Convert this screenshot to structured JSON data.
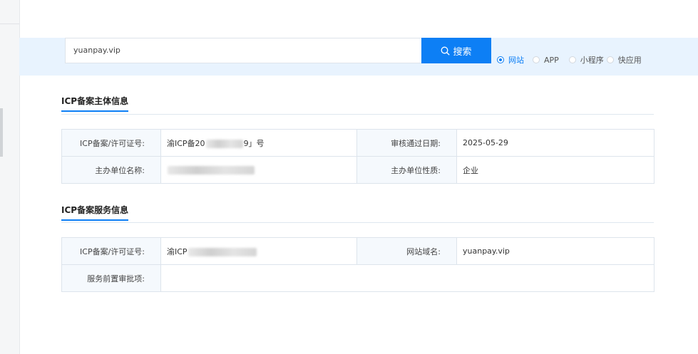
{
  "search": {
    "value": "yuanpay.vip",
    "button_label": "搜索",
    "options": [
      {
        "label": "网站",
        "checked": true
      },
      {
        "label": "APP",
        "checked": false
      },
      {
        "label": "小程序",
        "checked": false
      },
      {
        "label": "快应用",
        "checked": false
      }
    ]
  },
  "subject_section": {
    "title": "ICP备案主体信息",
    "rows": [
      {
        "k1": "ICP备案/许可证号:",
        "v1_prefix": "渝ICP备20",
        "v1_suffix": "9」号",
        "k2": "审核通过日期:",
        "v2": "2025-05-29"
      },
      {
        "k1": "主办单位名称:",
        "v1_prefix": "",
        "v1_suffix": "",
        "k2": "主办单位性质:",
        "v2": "企业"
      }
    ]
  },
  "service_section": {
    "title": "ICP备案服务信息",
    "rows": [
      {
        "k1": "ICP备案/许可证号:",
        "v1_prefix": "渝ICP",
        "v1_suffix": "",
        "k2": "网站域名:",
        "v2": "yuanpay.vip"
      },
      {
        "k1": "服务前置审批项:",
        "v1": ""
      }
    ]
  }
}
